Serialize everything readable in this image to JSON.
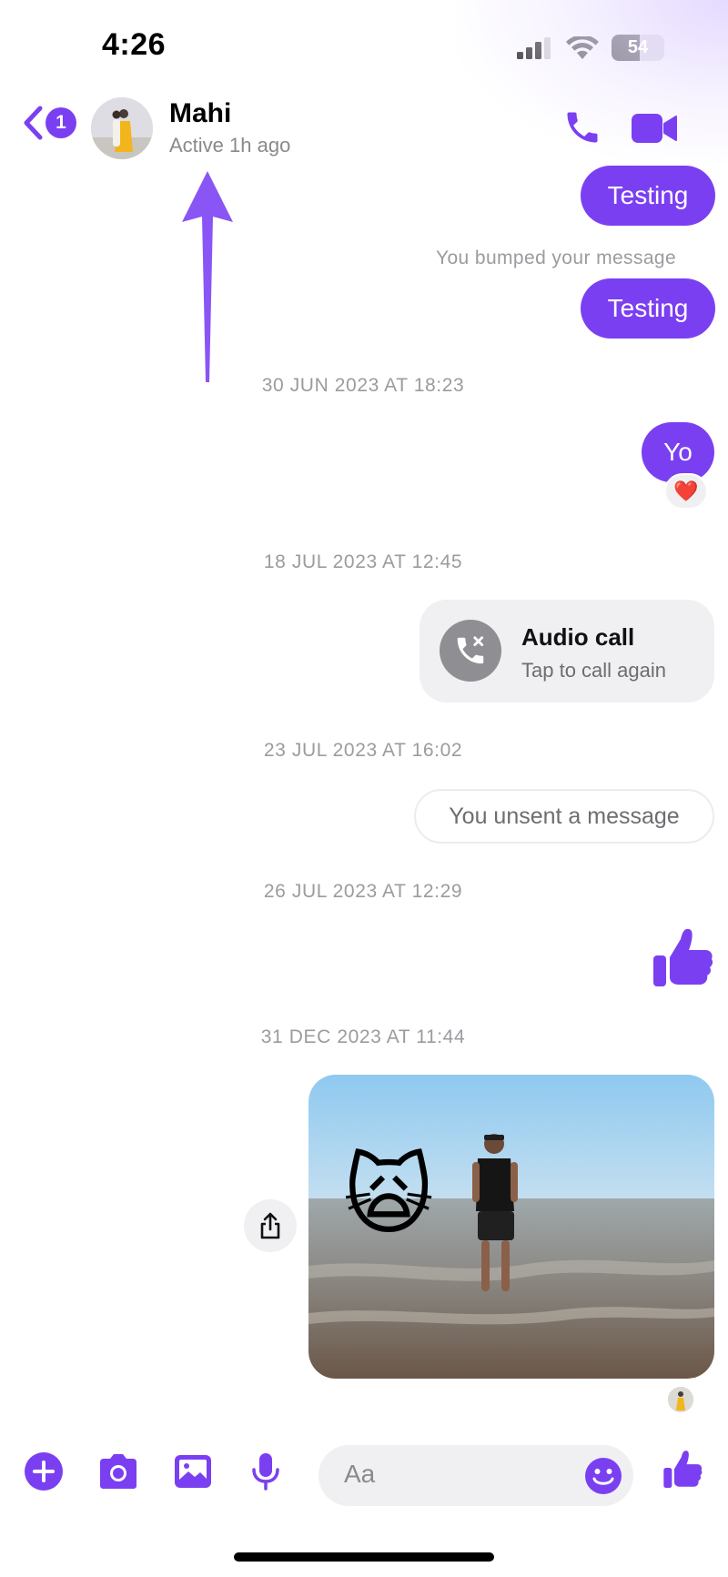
{
  "status_bar": {
    "time": "4:26",
    "battery": "54"
  },
  "header": {
    "back_badge": "1",
    "contact_name": "Mahi",
    "contact_status": "Active 1h ago"
  },
  "messages": {
    "testing_1": "Testing",
    "bump_note": "You bumped your message",
    "testing_2": "Testing",
    "ts_1": "30 JUN 2023 AT 18:23",
    "yo": "Yo",
    "reaction": "❤️",
    "ts_2": "18 JUL 2023 AT 12:45",
    "call_title": "Audio call",
    "call_subtitle": "Tap to call again",
    "ts_3": "23 JUL 2023 AT 16:02",
    "unsent": "You unsent a message",
    "ts_4": "26 JUL 2023 AT 12:29",
    "ts_5": "31 DEC 2023 AT 11:44",
    "photo_sticker": "🙀"
  },
  "composer": {
    "placeholder": "Aa"
  },
  "colors": {
    "accent": "#7b3ff2",
    "bubble_text": "#ffffff",
    "meta_text": "#9b9ba0"
  },
  "icons": [
    "signal-icon",
    "wifi-icon",
    "battery-icon",
    "back-chevron-icon",
    "phone-icon",
    "video-camera-icon",
    "missed-call-icon",
    "thumbs-up-icon",
    "share-icon",
    "plus-icon",
    "camera-icon",
    "gallery-icon",
    "microphone-icon",
    "emoji-icon"
  ]
}
